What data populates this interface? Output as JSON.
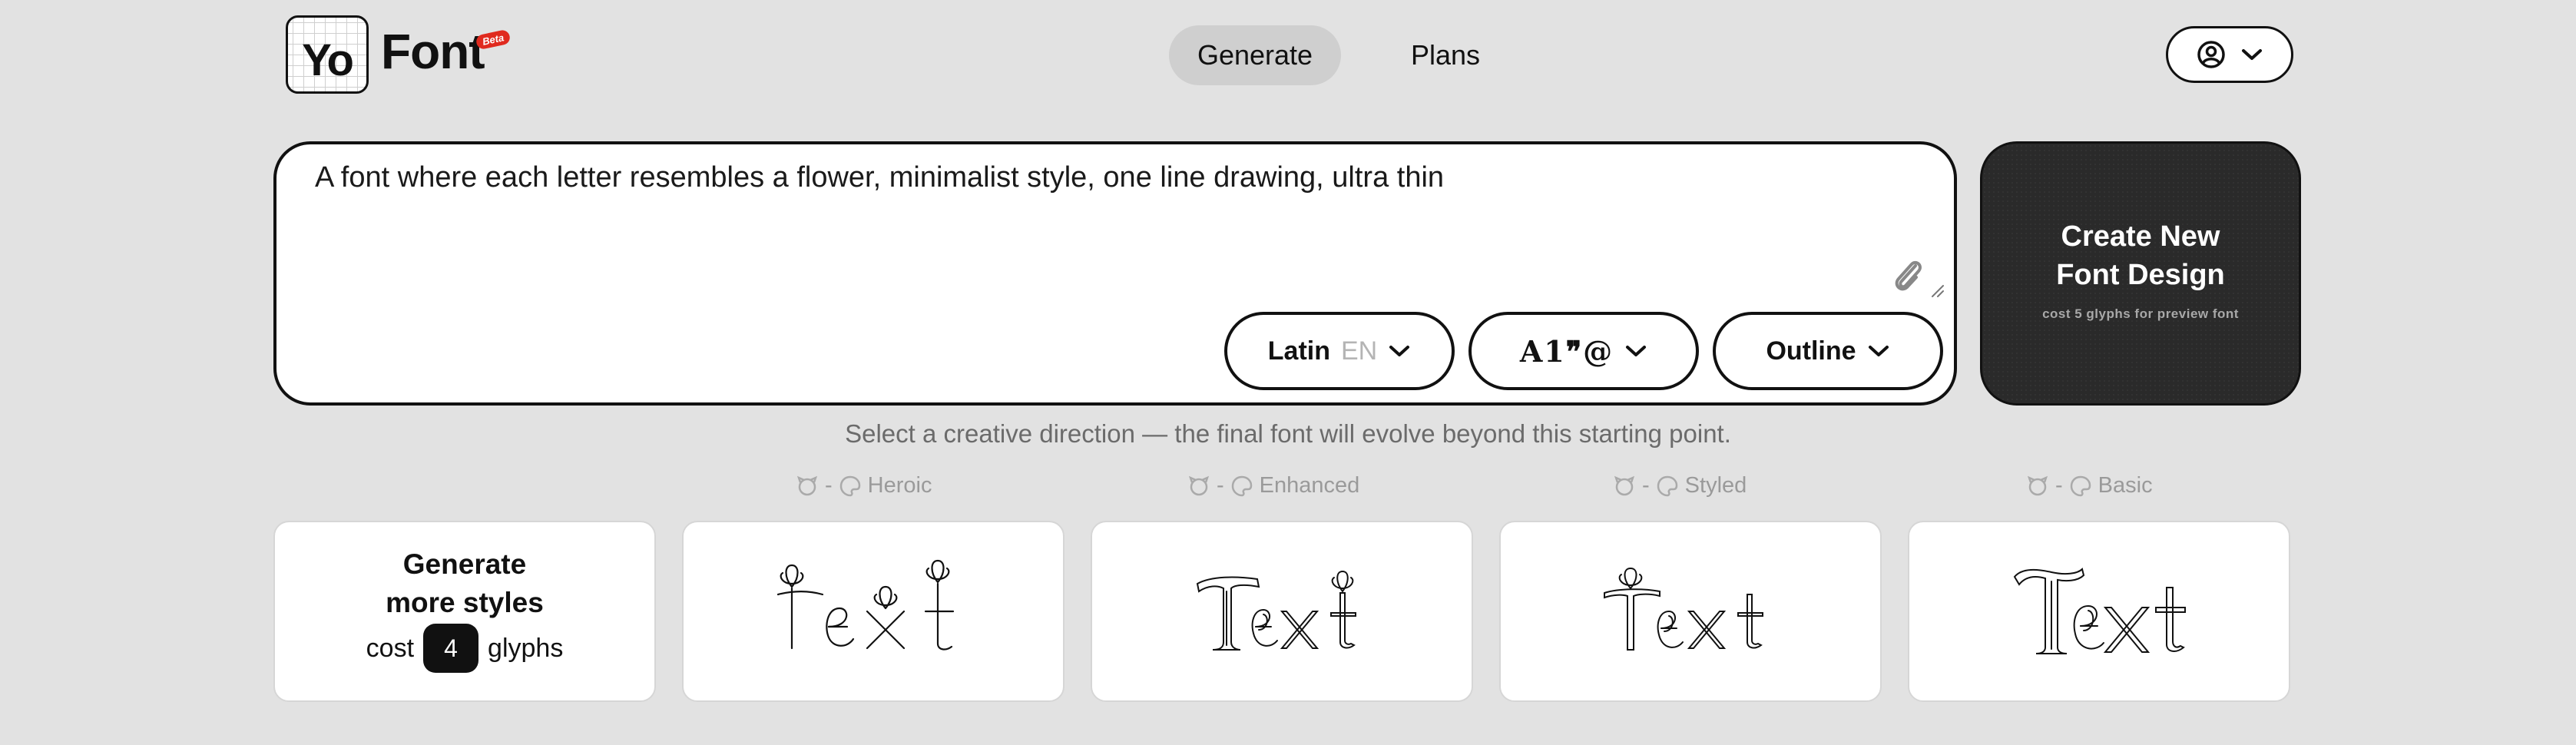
{
  "header": {
    "logo_mark": "Yo",
    "logo_text": "Font",
    "beta_badge": "Beta",
    "nav": [
      {
        "label": "Generate",
        "active": true
      },
      {
        "label": "Plans",
        "active": false
      }
    ],
    "account_icon": "user-circle-icon"
  },
  "prompt": {
    "value": "A font where each letter resembles a flower, minimalist style, one line drawing, ultra thin",
    "attach_icon": "paperclip-icon",
    "script_select": {
      "label": "Latin",
      "code": "EN"
    },
    "glyph_select": {
      "label": "A1❞@"
    },
    "style_select": {
      "label": "Outline"
    }
  },
  "create_button": {
    "title": "Create New\nFont Design",
    "subtitle": "cost 5 glyphs for preview font"
  },
  "helper_text": "Select a creative direction — the final font will evolve beyond this starting point.",
  "more_styles": {
    "title": "Generate\nmore styles",
    "cost_prefix": "cost",
    "cost_value": "4",
    "cost_suffix": "glyphs"
  },
  "style_cards": [
    {
      "count": "-",
      "style": "Heroic",
      "preview": "Text"
    },
    {
      "count": "-",
      "style": "Enhanced",
      "preview": "Text"
    },
    {
      "count": "-",
      "style": "Styled",
      "preview": "Text"
    },
    {
      "count": "-",
      "style": "Basic",
      "preview": "Text"
    }
  ],
  "colors": {
    "background": "#e2e2e2",
    "primary": "#111111",
    "active_nav": "#cfcfcf",
    "beta": "#e02a1e"
  }
}
